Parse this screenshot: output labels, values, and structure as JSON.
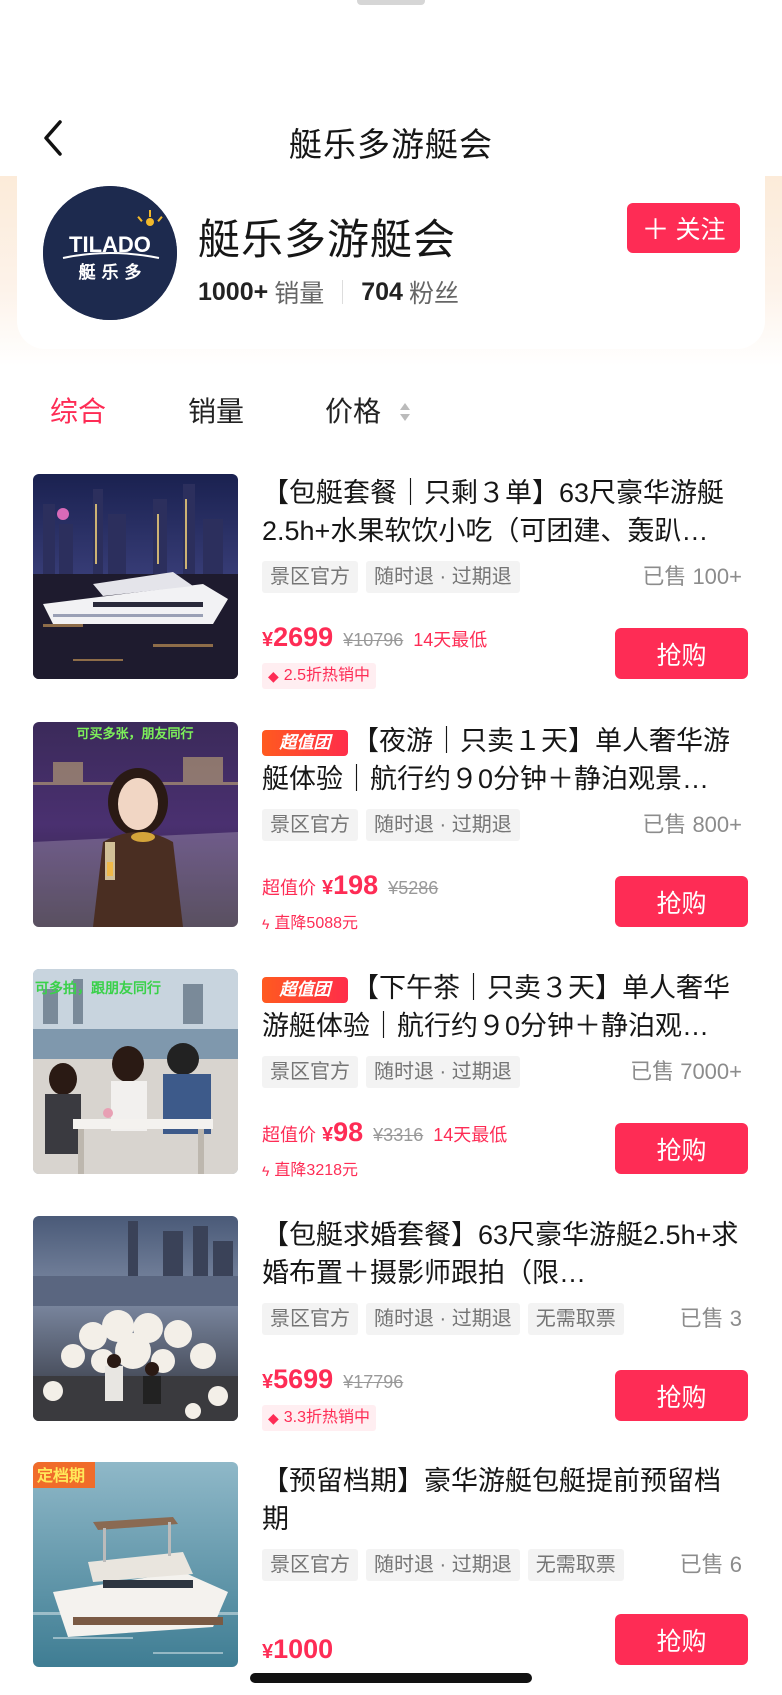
{
  "header": {
    "title": "艇乐多游艇会"
  },
  "shop": {
    "name": "艇乐多游艇会",
    "logo_text_en": "TILADO",
    "logo_text_cn": "艇 乐 多",
    "sales_value": "1000+",
    "sales_label": "销量",
    "fans_value": "704",
    "fans_label": "粉丝",
    "follow_label": "关注"
  },
  "sort": {
    "tabs": [
      "综合",
      "销量",
      "价格"
    ],
    "active": "综合"
  },
  "colors": {
    "accent": "#fe2c55",
    "tag_bg": "#f3f3f3",
    "logo_bg": "#1d2a4e"
  },
  "products": [
    {
      "title": "【包艇套餐｜只剩３单】63尺豪华游艇2.5h+水果软饮小吃（可团建、轰趴…",
      "super_badge": "",
      "tags": [
        "景区官方",
        "随时退 · 过期退"
      ],
      "sold": "已售 100+",
      "price_label": "",
      "yen": "¥",
      "price": "2699",
      "orig_price": "¥10796",
      "low_label": "14天最低",
      "promo": "2.5折热销中",
      "promo_icon": "tag-icon",
      "thumb_caption": "",
      "buy_label": "抢购"
    },
    {
      "title": "【夜游｜只卖１天】单人奢华游艇体验｜航行约９0分钟＋静泊观景…",
      "super_badge": "超值团",
      "tags": [
        "景区官方",
        "随时退 · 过期退"
      ],
      "sold": "已售 800+",
      "price_label": "超值价",
      "yen": "¥",
      "price": "198",
      "orig_price": "¥5286",
      "low_label": "",
      "promo": "直降5088元",
      "promo_icon": "lightning-icon",
      "thumb_caption": "可买多张，朋友同行",
      "buy_label": "抢购"
    },
    {
      "title": "【下午茶｜只卖３天】单人奢华游艇体验｜航行约９0分钟＋静泊观…",
      "super_badge": "超值团",
      "tags": [
        "景区官方",
        "随时退 · 过期退"
      ],
      "sold": "已售 7000+",
      "price_label": "超值价",
      "yen": "¥",
      "price": "98",
      "orig_price": "¥3316",
      "low_label": "14天最低",
      "promo": "直降3218元",
      "promo_icon": "lightning-icon",
      "thumb_caption": "可多拍，跟朋友同行",
      "buy_label": "抢购"
    },
    {
      "title": "【包艇求婚套餐】63尺豪华游艇2.5h+求婚布置＋摄影师跟拍（限…",
      "super_badge": "",
      "tags": [
        "景区官方",
        "随时退 · 过期退",
        "无需取票"
      ],
      "sold": "已售 3",
      "price_label": "",
      "yen": "¥",
      "price": "5699",
      "orig_price": "¥17796",
      "low_label": "",
      "promo": "3.3折热销中",
      "promo_icon": "tag-icon",
      "thumb_caption": "",
      "buy_label": "抢购"
    },
    {
      "title": "【预留档期】豪华游艇包艇提前预留档期",
      "super_badge": "",
      "tags": [
        "景区官方",
        "随时退 · 过期退",
        "无需取票"
      ],
      "sold": "已售 6",
      "price_label": "",
      "yen": "¥",
      "price": "1000",
      "orig_price": "",
      "low_label": "",
      "promo": "",
      "promo_icon": "",
      "thumb_caption": "定档期",
      "buy_label": "抢购"
    }
  ]
}
